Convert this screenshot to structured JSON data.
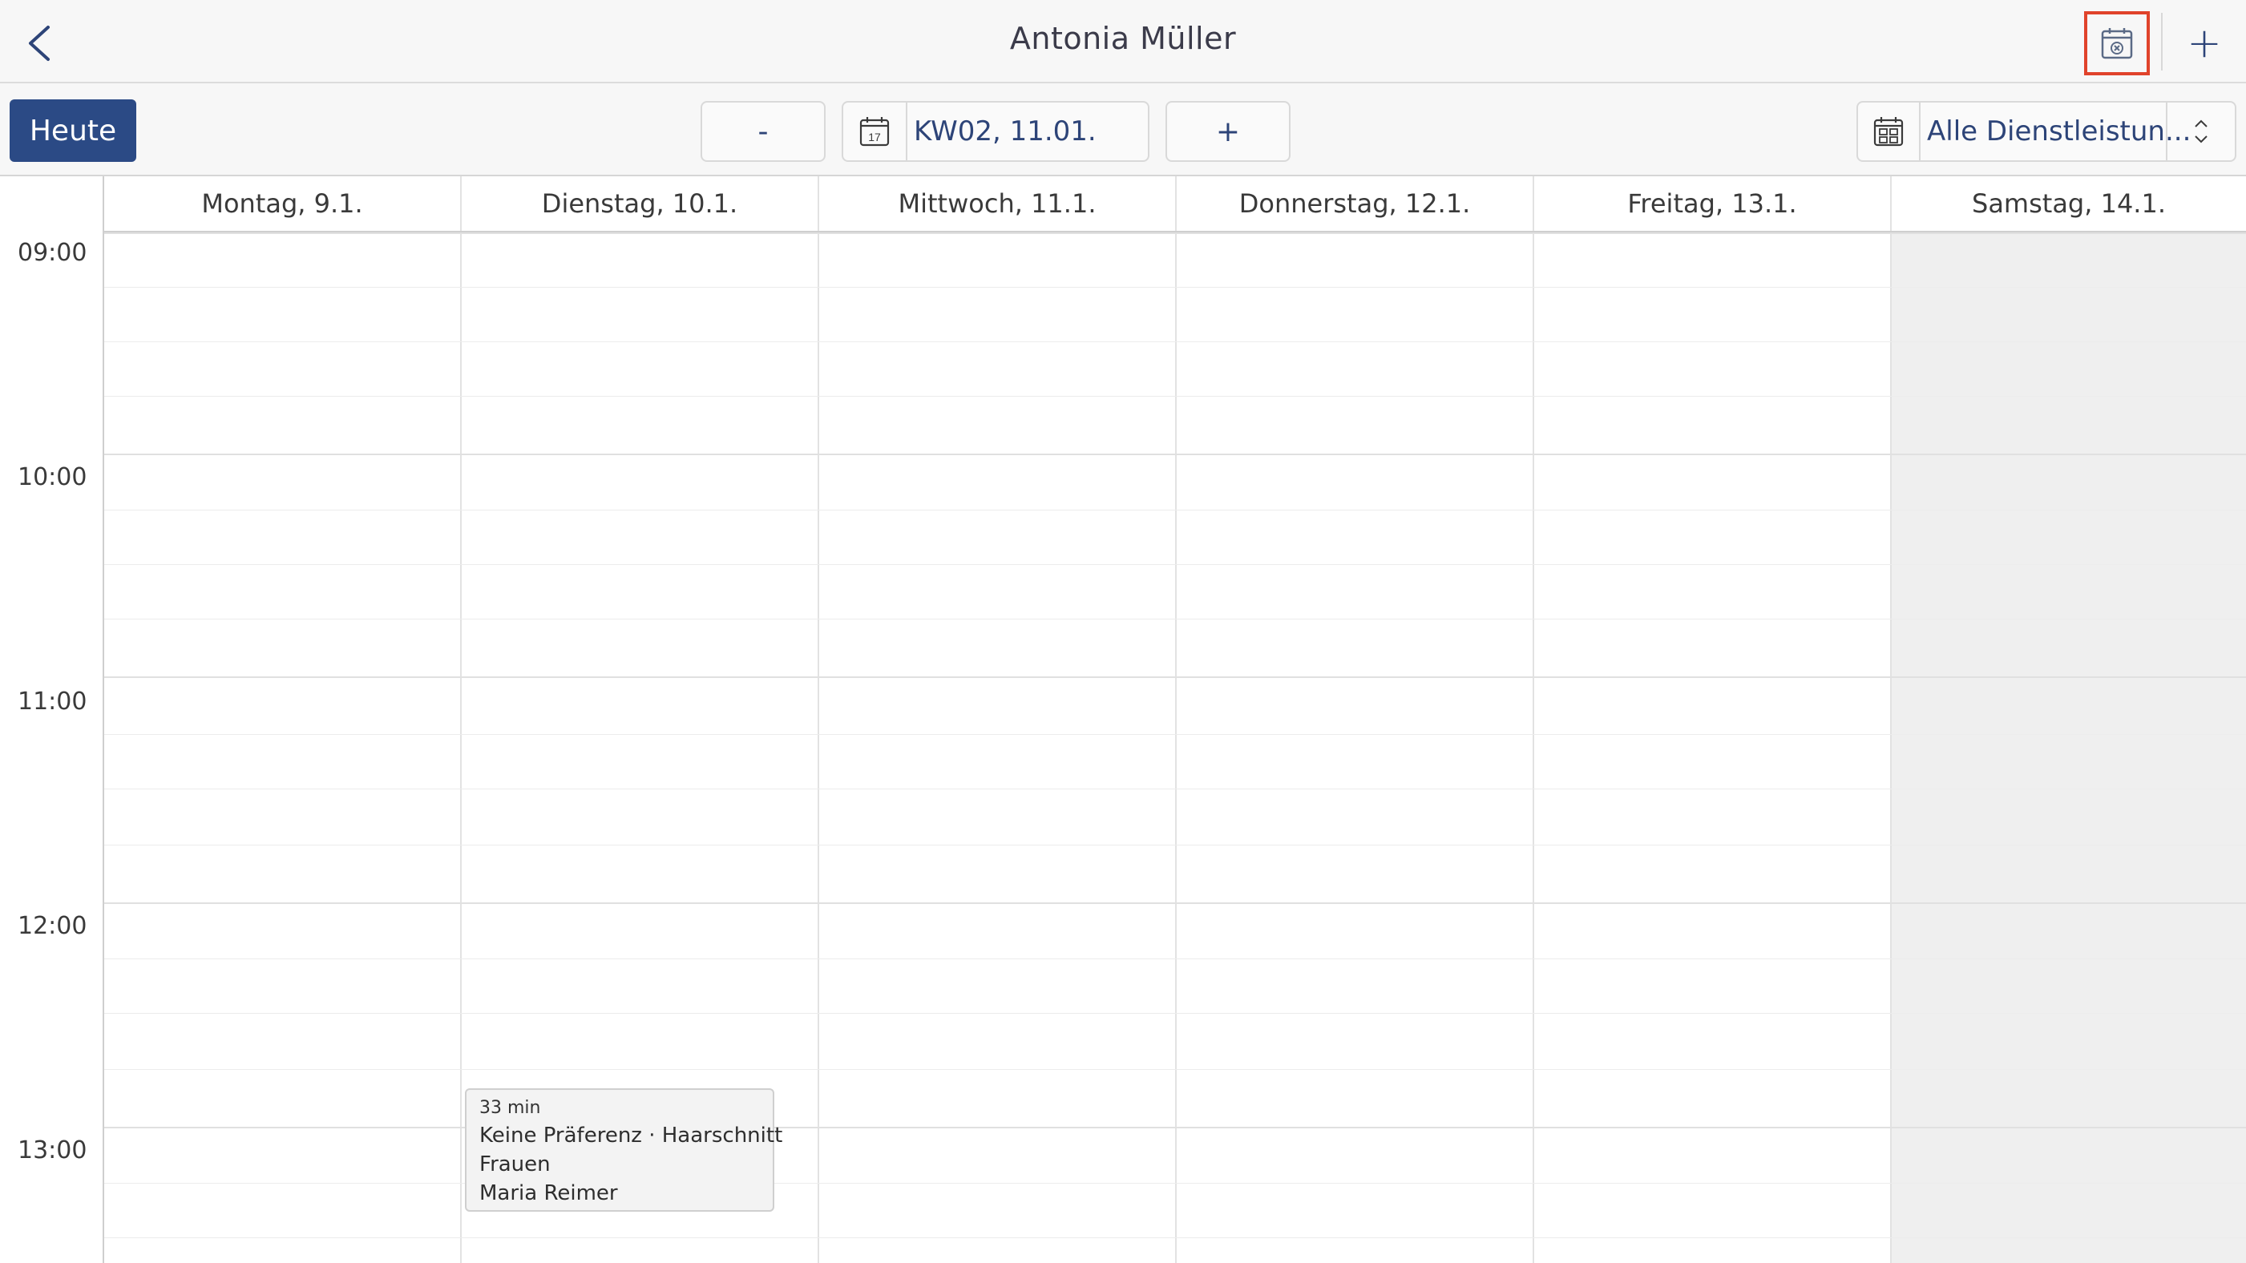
{
  "header": {
    "title": "Antonia Müller",
    "plus_label": "+"
  },
  "toolbar": {
    "today_label": "Heute",
    "prev_label": "-",
    "next_label": "+",
    "date_value": "KW02, 11.01.",
    "date_icon_day": "17",
    "service_value": "Alle Dienstleistun..."
  },
  "times": [
    "09:00",
    "10:00",
    "11:00",
    "12:00",
    "13:00"
  ],
  "days": [
    {
      "label": "Montag, 9.1."
    },
    {
      "label": "Dienstag, 10.1."
    },
    {
      "label": "Mittwoch, 11.1."
    },
    {
      "label": "Donnerstag, 12.1."
    },
    {
      "label": "Freitag, 13.1."
    },
    {
      "label": "Samstag, 14.1."
    }
  ],
  "appointment": {
    "duration": "33 min",
    "line1": "Keine Präferenz · Haarschnitt",
    "line2": "Frauen",
    "line3": "Maria Reimer"
  },
  "colors": {
    "accent": "#2b4a85",
    "highlight": "#e0432b",
    "weekend": "#efefef"
  },
  "icons": {
    "back": "chevron-left-icon",
    "calendar_cancel": "calendar-cancel-icon",
    "date": "calendar-icon",
    "service": "calendar-grid-icon",
    "select": "chevron-up-down-icon"
  }
}
